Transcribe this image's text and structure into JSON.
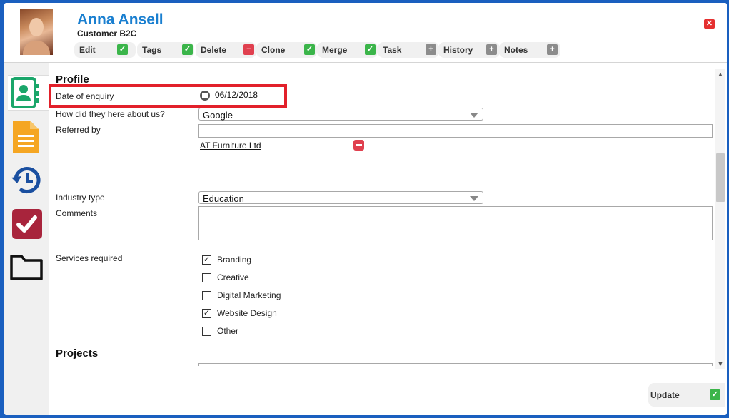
{
  "contact": {
    "name": "Anna Ansell",
    "type": "Customer B2C"
  },
  "toolbar": {
    "edit": "Edit",
    "tags": "Tags",
    "delete": "Delete",
    "clone": "Clone",
    "merge": "Merge",
    "task": "Task",
    "history": "History",
    "notes": "Notes"
  },
  "profile": {
    "title": "Profile",
    "date_label": "Date of enquiry",
    "date_value": "06/12/2018",
    "source_label": "How did they here about us?",
    "source_value": "Google",
    "referred_label": "Referred by",
    "referred_value": "",
    "referred_link": "AT Furniture Ltd",
    "industry_label": "Industry type",
    "industry_value": "Education",
    "comments_label": "Comments",
    "comments_value": "",
    "services_label": "Services required",
    "services": [
      {
        "label": "Branding",
        "checked": true
      },
      {
        "label": "Creative",
        "checked": false
      },
      {
        "label": "Digital Marketing",
        "checked": false
      },
      {
        "label": "Website Design",
        "checked": true
      },
      {
        "label": "Other",
        "checked": false
      }
    ]
  },
  "projects": {
    "title": "Projects"
  },
  "footer": {
    "update": "Update"
  },
  "colors": {
    "accent": "#1a7fd0",
    "frame": "#1a5fbf",
    "highlight": "#e2202a",
    "ok": "#3bb54a",
    "remove": "#e0404f",
    "neutral": "#8c8c8c",
    "contact_tab": "#1aa66a",
    "document_tab": "#f5a623",
    "history_tab": "#1a4fa0",
    "task_tab": "#a8243c",
    "folder_tab": "#111111"
  },
  "icons": {
    "close": "close-icon",
    "calendar": "calendar-icon",
    "tab_contact": "contact-card-icon",
    "tab_documents": "document-icon",
    "tab_history": "history-icon",
    "tab_tasks": "task-check-icon",
    "tab_files": "folder-icon"
  }
}
